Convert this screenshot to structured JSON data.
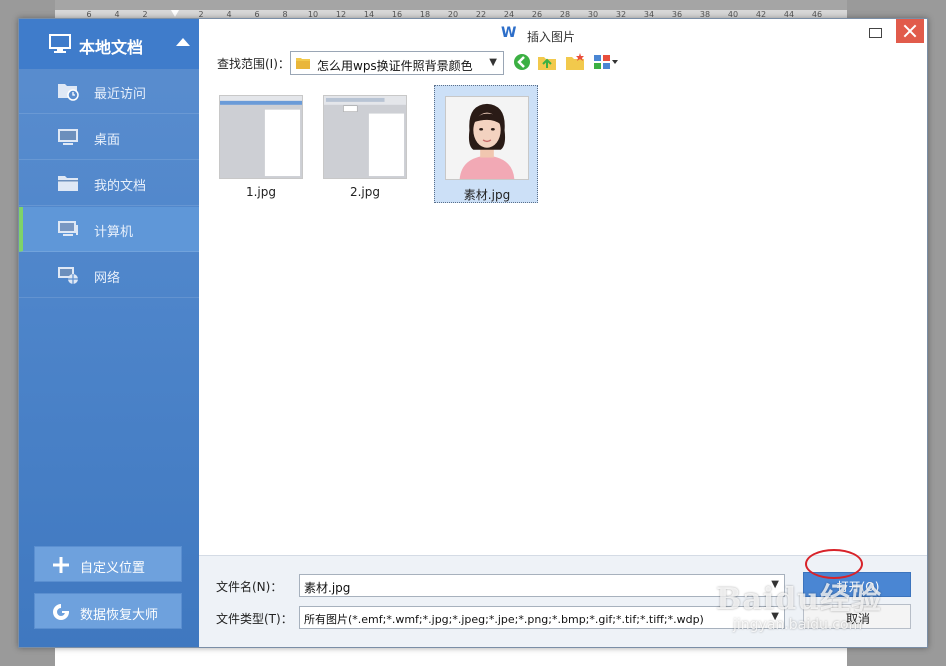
{
  "ruler": {
    "left_numbers": [
      "6",
      "4",
      "2"
    ],
    "right_numbers": [
      "2",
      "4",
      "6",
      "8",
      "10",
      "12",
      "14",
      "16",
      "18",
      "20",
      "22",
      "24",
      "26",
      "28",
      "30",
      "32",
      "34",
      "36",
      "38",
      "40",
      "42",
      "44",
      "46"
    ]
  },
  "sidebar": {
    "title": "本地文档",
    "items": [
      {
        "label": "最近访问",
        "icon": "recent-folder-icon"
      },
      {
        "label": "桌面",
        "icon": "desktop-icon"
      },
      {
        "label": "我的文档",
        "icon": "folder-icon"
      },
      {
        "label": "计算机",
        "icon": "computer-icon",
        "active": true
      },
      {
        "label": "网络",
        "icon": "network-icon"
      }
    ],
    "buttons": {
      "custom_location": "自定义位置",
      "data_recovery": "数据恢复大师"
    }
  },
  "dialog": {
    "app_logo": "W",
    "title": "插入图片"
  },
  "toolbar": {
    "lookin_label": "查找范围(I)：",
    "lookin_value": "怎么用wps换证件照背景颜色",
    "icons": [
      "back-icon",
      "up-folder-icon",
      "new-folder-icon",
      "view-menu-icon"
    ]
  },
  "files": [
    {
      "name": "1.jpg",
      "selected": false
    },
    {
      "name": "2.jpg",
      "selected": false
    },
    {
      "name": "素材.jpg",
      "selected": true
    }
  ],
  "footer": {
    "filename_label": "文件名(N)：",
    "filename_value": "素材.jpg",
    "filetype_label": "文件类型(T)：",
    "filetype_value": "所有图片(*.emf;*.wmf;*.jpg;*.jpeg;*.jpe;*.png;*.bmp;*.gif;*.tif;*.tiff;*.wdp)",
    "open_button": "打开(O)",
    "cancel_button": "取消"
  },
  "watermark": {
    "brand": "Baidu经验",
    "url": "jingyan.baidu.com"
  },
  "colors": {
    "sidebar": "#4f86cb",
    "active_accent": "#7ed36a",
    "close_button": "#e15b4b",
    "primary_button": "#4a86d3",
    "highlight": "#d8232a"
  }
}
